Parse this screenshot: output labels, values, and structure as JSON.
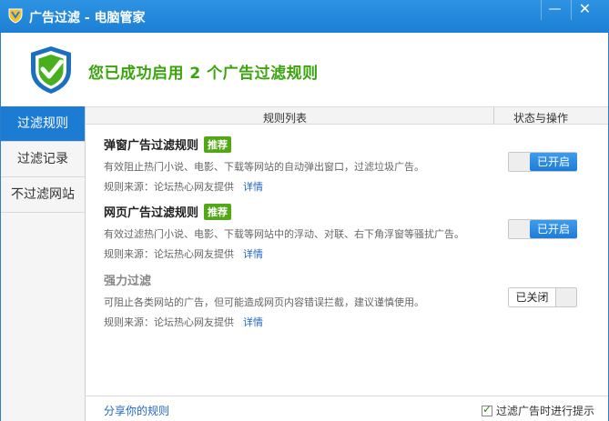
{
  "window": {
    "title": "广告过滤 - 电脑管家",
    "minimize_glyph": "—",
    "close_glyph": "✕"
  },
  "banner": {
    "headline": "您已成功启用 2 个广告过滤规则"
  },
  "sidebar": {
    "items": [
      {
        "label": "过滤规则",
        "active": true
      },
      {
        "label": "过滤记录",
        "active": false
      },
      {
        "label": "不过滤网站",
        "active": false
      }
    ]
  },
  "table": {
    "col_rules": "规则列表",
    "col_status": "状态与操作"
  },
  "rules": [
    {
      "name": "弹窗广告过滤规则",
      "tag": "推荐",
      "desc": "有效阻止热门小说、电影、下载等网站的自动弹出窗口，过滤垃圾广告。",
      "source": "规则来源：论坛热心网友提供",
      "detail": "详情",
      "status": "已开启"
    },
    {
      "name": "网页广告过滤规则",
      "tag": "推荐",
      "desc": "有效过滤热门小说、电影、下载等网站中的浮动、对联、右下角浮窗等骚扰广告。",
      "source": "规则来源：论坛热心网友提供",
      "detail": "详情",
      "status": "已开启"
    },
    {
      "name": "强力过滤",
      "desc": "可阻止各类网站的广告，但可能造成网页内容错误拦截，建议谨慎使用。",
      "source": "规则来源：论坛热心网友提供",
      "detail": "详情",
      "status": "已关闭"
    }
  ],
  "footer": {
    "share": "分享你的规则",
    "notify": "过滤广告时进行提示"
  },
  "colors": {
    "titlebar": "#1b7fd4",
    "accent_green": "#3aa40d",
    "toggle_on": "#1e7cd8",
    "link": "#2067c8"
  }
}
